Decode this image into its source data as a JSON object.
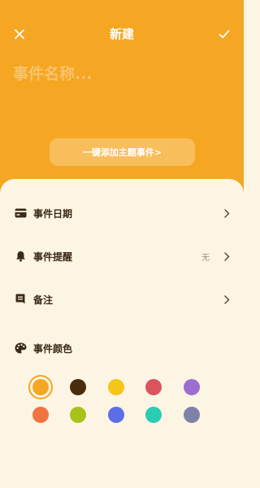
{
  "header": {
    "title": "新建",
    "close_icon": "close-icon",
    "confirm_icon": "check-icon"
  },
  "name_input": {
    "placeholder": "事件名称...",
    "value": ""
  },
  "theme_button": {
    "label": "一键添加主题事件>"
  },
  "rows": [
    {
      "label": "事件日期",
      "icon": "calendar-card-icon",
      "value": ""
    },
    {
      "label": "事件提醒",
      "icon": "bell-icon",
      "value": "无"
    },
    {
      "label": "备注",
      "icon": "note-icon",
      "value": ""
    },
    {
      "label": "事件颜色",
      "icon": "palette-icon"
    }
  ],
  "colors": {
    "selected_index": 0,
    "swatches": [
      "#F5A623",
      "#4A2C0F",
      "#F5C518",
      "#D9545E",
      "#9B6FD1",
      "#F07340",
      "#A9C21B",
      "#5B6EE8",
      "#2BCBB4",
      "#7F82A8"
    ]
  },
  "theme": {
    "accent": "#F5A623",
    "sheet_bg": "#FDF5E4",
    "text_dark": "#3A2A17"
  }
}
